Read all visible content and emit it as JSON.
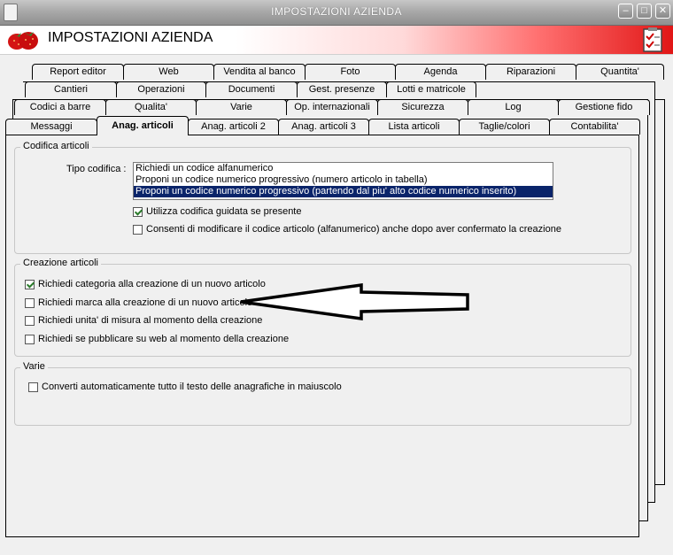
{
  "window": {
    "title": "IMPOSTAZIONI AZIENDA",
    "buttons": {
      "minimize": "–",
      "maximize": "□",
      "close": "✕"
    }
  },
  "header": {
    "title": "IMPOSTAZIONI AZIENDA"
  },
  "tabs": {
    "row1": [
      "Report editor",
      "Web",
      "Vendita al banco",
      "Foto",
      "Agenda",
      "Riparazioni",
      "Quantita'"
    ],
    "row2": [
      "Cantieri",
      "Operazioni",
      "Documenti",
      "Gest. presenze",
      "Lotti e matricole"
    ],
    "row3": [
      "Codici a barre",
      "Qualita'",
      "Varie",
      "Op. internazionali",
      "Sicurezza",
      "Log",
      "Gestione fido"
    ],
    "row4": [
      "Messaggi",
      "Anag. articoli",
      "Anag. articoli 2",
      "Anag. articoli 3",
      "Lista articoli",
      "Taglie/colori",
      "Contabilita'"
    ],
    "active": "Anag. articoli"
  },
  "codifica": {
    "label": "Codifica articoli",
    "tipo_label": "Tipo codifica :",
    "options": [
      "Richiedi un codice alfanumerico",
      "Proponi un codice numerico progressivo (numero articolo in tabella)",
      "Proponi un codice numerico progressivo (partendo dal piu' alto codice numerico inserito)"
    ],
    "selected_index": 2,
    "checks": [
      {
        "label": "Utilizza codifica guidata se presente",
        "checked": true
      },
      {
        "label": "Consenti di modificare il codice articolo (alfanumerico) anche dopo aver confermato la creazione",
        "checked": false
      }
    ]
  },
  "creazione": {
    "label": "Creazione articoli",
    "checks": [
      {
        "label": "Richiedi categoria alla creazione di un nuovo articolo",
        "checked": true
      },
      {
        "label": "Richiedi marca alla creazione di un nuovo articolo",
        "checked": false
      },
      {
        "label": "Richiedi unita' di misura al momento della creazione",
        "checked": false
      },
      {
        "label": "Richiedi se pubblicare su web al momento della creazione",
        "checked": false
      }
    ]
  },
  "varie": {
    "label": "Varie",
    "checks": [
      {
        "label": "Converti automaticamente tutto il testo delle anagrafiche in maiuscolo",
        "checked": false
      }
    ]
  },
  "icons": {
    "logo": "strawberries-icon",
    "checklist": "checklist-icon",
    "arrow": "arrow-left-annotation"
  }
}
